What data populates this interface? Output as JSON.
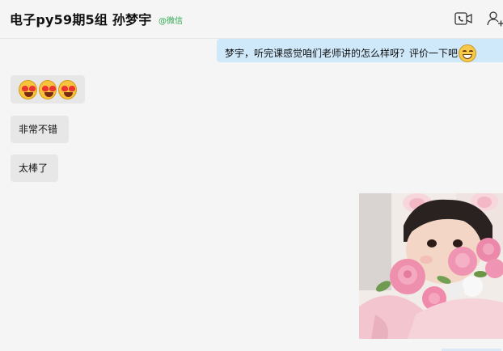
{
  "header": {
    "title": "电子py59期5组 孙梦宇",
    "wechat_tag": "@微信",
    "icons": [
      "video-call-icon",
      "add-member-icon"
    ]
  },
  "messages": [
    {
      "direction": "out",
      "text": "梦宇，听完课感觉咱们老师讲的怎么样呀？评价一下吧",
      "trailing_emoji": "grin-icon"
    },
    {
      "direction": "in",
      "emoji": [
        "heart-eyes-icon",
        "heart-eyes-icon",
        "heart-eyes-icon"
      ]
    },
    {
      "direction": "in",
      "text": "非常不错"
    },
    {
      "direction": "in",
      "text": "太棒了"
    },
    {
      "direction": "in",
      "image": "child-with-pink-roses-photo"
    }
  ],
  "colors": {
    "background": "#f5f5f5",
    "outgoing_bubble": "#cfe9fb",
    "incoming_bubble": "#e7e7e7",
    "wechat_tag": "#2fa84f"
  }
}
